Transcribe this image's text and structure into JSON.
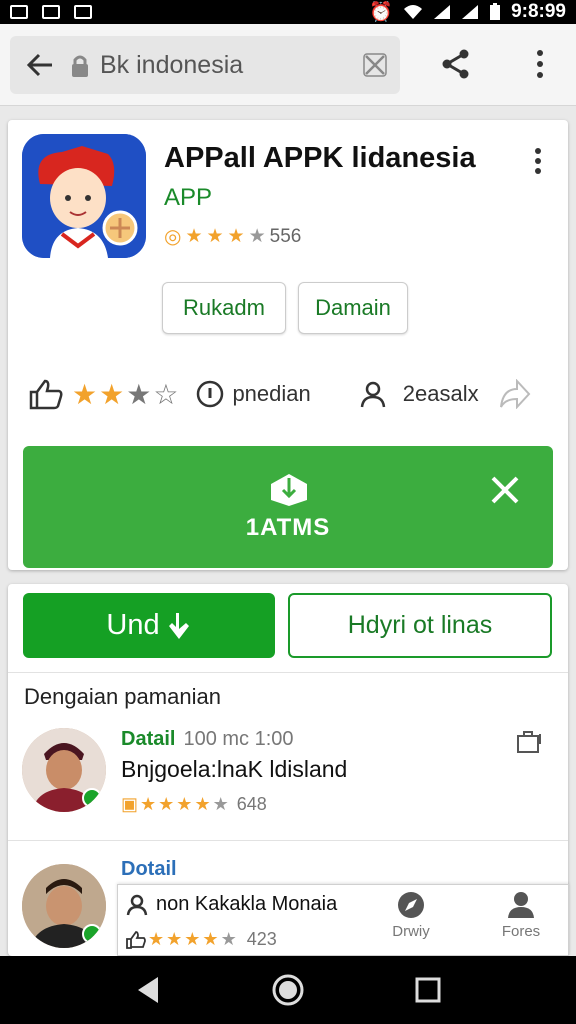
{
  "status_bar": {
    "time": "9:8:99"
  },
  "toolbar": {
    "url_text": "Bk indonesia"
  },
  "app": {
    "title": "APPall APPK lidanesia",
    "subtitle": "APP",
    "rating_count": "556",
    "chips": [
      "Rukadm",
      "Damain"
    ]
  },
  "stats": {
    "rating_text": "pnedian",
    "users_text": "2easalx"
  },
  "install_banner": {
    "label": "1ATMS"
  },
  "actions": {
    "primary_label": "Und",
    "secondary_label": "Hdyri ot linas"
  },
  "section": {
    "title": "Dengaian pamanian"
  },
  "reviews": [
    {
      "head": "Datail",
      "meta": "100 mc 1:00",
      "name": "Bnjgoela:lnaK ldisland",
      "count": "648"
    },
    {
      "head": "Dotail",
      "meta": "",
      "name": "non Kakakla Monaia",
      "count": "423"
    }
  ],
  "bottom_tabs": [
    {
      "label": "Drwiy",
      "icon": "compass-icon"
    },
    {
      "label": "Fores",
      "icon": "person-icon"
    }
  ],
  "colors": {
    "accent_green": "#3cad3f",
    "primary_green": "#15a024",
    "brand_blue": "#1f4fc4",
    "star": "#f2a22c"
  }
}
